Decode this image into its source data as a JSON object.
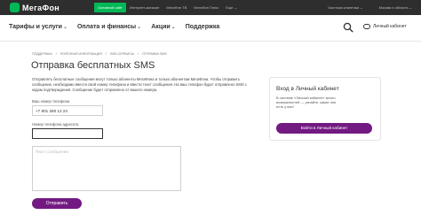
{
  "brand": {
    "name": "МегаФон"
  },
  "topbar": {
    "segments": [
      "Основной сайт",
      "Интернет-магазин",
      "МегаФон ТВ",
      "МегаФон Плюс",
      "Еще ⌄"
    ],
    "right": [
      "Частным клиентам ⌄",
      "Москва и область ⌄"
    ]
  },
  "nav": {
    "items": [
      "Тарифы и услуги",
      "Оплата и финансы",
      "Акции",
      "Поддержка"
    ],
    "chevron": "⌄",
    "account_label": "Личный кабинет"
  },
  "breadcrumbs": [
    "Поддержка",
    "Полезная информация",
    "SMS-сервисы",
    "Отправка SMS"
  ],
  "page": {
    "title": "Отправка бесплатных SMS",
    "description": "Отправлять бесплатные сообщения могут только абоненты МегаФона и только абонентам МегаФона. Чтобы отправить сообщение, необходимо ввести свой номер телефона и ввести текст сообщения. На ваш телефон будет отправлено SMS с кодом подтверждения. Сообщение будет отправлено от вашего номера.",
    "your_number_label": "Ваш номер телефона",
    "your_number_value": "+7 901 260 12 24",
    "recipient_label": "Номер телефона адресата",
    "recipient_value": "",
    "message_placeholder": "Текст сообщения",
    "send_button": "Отправить"
  },
  "account_card": {
    "title": "Вход в Личный кабинет",
    "text": "В системе «Личный кабинет» много возможностей — узнайте, какие они есть у вас!",
    "button": "Войти в Личный кабинет"
  },
  "colors": {
    "brand_green": "#00b956",
    "brand_purple": "#731982",
    "topbar_bg": "#2e2e2e"
  }
}
